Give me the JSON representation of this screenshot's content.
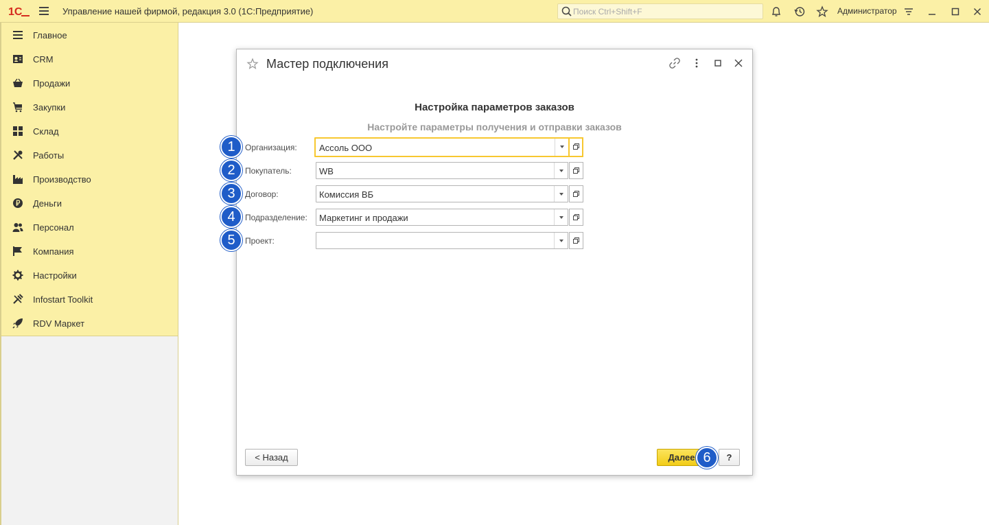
{
  "topbar": {
    "logo_text": "1С",
    "app_title": "Управление нашей фирмой, редакция 3.0  (1С:Предприятие)",
    "search_placeholder": "Поиск Ctrl+Shift+F",
    "user": "Администратор",
    "icons": [
      "bell-icon",
      "history-icon",
      "star-icon",
      "settings-menu-icon",
      "minimize-icon",
      "maximize-icon",
      "close-icon"
    ]
  },
  "sidebar": {
    "items": [
      {
        "label": "Главное",
        "icon": "menu-lines-icon"
      },
      {
        "label": "CRM",
        "icon": "contact-card-icon"
      },
      {
        "label": "Продажи",
        "icon": "basket-icon"
      },
      {
        "label": "Закупки",
        "icon": "cart-icon"
      },
      {
        "label": "Склад",
        "icon": "boxes-icon"
      },
      {
        "label": "Работы",
        "icon": "tools-icon"
      },
      {
        "label": "Производство",
        "icon": "factory-icon"
      },
      {
        "label": "Деньги",
        "icon": "ruble-icon"
      },
      {
        "label": "Персонал",
        "icon": "people-icon"
      },
      {
        "label": "Компания",
        "icon": "flag-icon"
      },
      {
        "label": "Настройки",
        "icon": "gear-icon"
      },
      {
        "label": "Infostart Toolkit",
        "icon": "wrench-icon"
      },
      {
        "label": "RDV Маркет",
        "icon": "rocket-icon"
      }
    ]
  },
  "dialog": {
    "title": "Мастер подключения",
    "heading": "Настройка параметров заказов",
    "subheading": "Настройте параметры получения и отправки заказов",
    "fields": [
      {
        "badge": "1",
        "label": "Организация:",
        "value": "Ассоль ООО"
      },
      {
        "badge": "2",
        "label": "Покупатель:",
        "value": "WB"
      },
      {
        "badge": "3",
        "label": "Договор:",
        "value": "Комиссия ВБ"
      },
      {
        "badge": "4",
        "label": "Подразделение:",
        "value": "Маркетинг и продажи"
      },
      {
        "badge": "5",
        "label": "Проект:",
        "value": ""
      }
    ],
    "back_label": "< Назад",
    "next_label": "Далее",
    "next_badge": "6",
    "help_label": "?"
  },
  "colors": {
    "panel_yellow": "#fbf0a6",
    "accent_yellow": "#f2cc17",
    "focus_border": "#f7c72f",
    "badge_blue": "#1f5cc8",
    "logo_red": "#d52b1e"
  }
}
